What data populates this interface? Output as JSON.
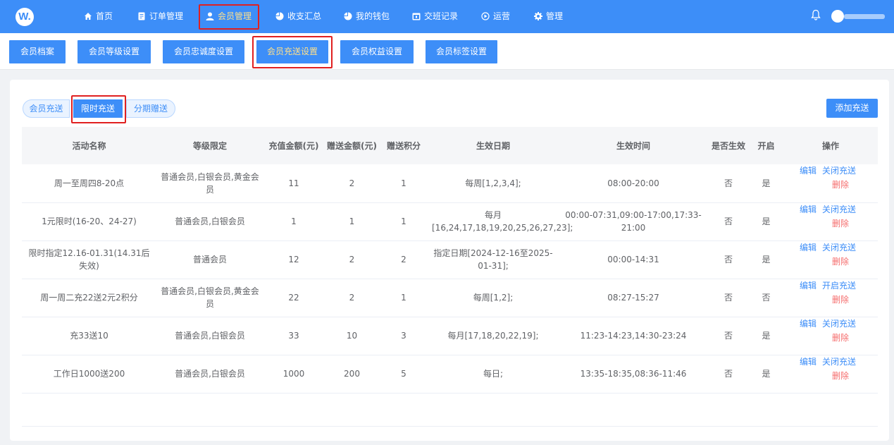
{
  "brand": {
    "logo_text": "W."
  },
  "nav": [
    {
      "label": "首页",
      "icon": "home-icon"
    },
    {
      "label": "订单管理",
      "icon": "document-icon"
    },
    {
      "label": "会员管理",
      "icon": "user-icon",
      "active": true
    },
    {
      "label": "收支汇总",
      "icon": "pie-chart-icon"
    },
    {
      "label": "我的钱包",
      "icon": "wallet-icon"
    },
    {
      "label": "交班记录",
      "icon": "calendar-icon"
    },
    {
      "label": "运营",
      "icon": "compass-icon"
    },
    {
      "label": "管理",
      "icon": "gear-icon"
    }
  ],
  "subtabs": [
    "会员档案",
    "会员等级设置",
    "会员忠诚度设置",
    "会员充送设置",
    "会员权益设置",
    "会员标签设置"
  ],
  "subtabs_active": "会员充送设置",
  "segments": [
    "会员充送",
    "限时充送",
    "分期赠送"
  ],
  "segments_active": "限时充送",
  "add_button": "添加充送",
  "table": {
    "headers": [
      "活动名称",
      "等级限定",
      "充值金额(元)",
      "赠送金额(元)",
      "赠送积分",
      "生效日期",
      "生效时间",
      "是否生效",
      "开启",
      "操作"
    ],
    "rows": [
      {
        "name": "周一至周四8-20点",
        "level": "普通会员,白银会员,黄金会员",
        "amount": "11",
        "gift": "2",
        "points": "1",
        "date": "每周[1,2,3,4];",
        "time": "08:00-20:00",
        "effective": "否",
        "enabled": "是",
        "op_edit": "编辑",
        "op_toggle": "关闭充送",
        "op_delete": "删除"
      },
      {
        "name": "1元限时(16-20、24-27)",
        "level": "普通会员,白银会员",
        "amount": "1",
        "gift": "1",
        "points": "1",
        "date": "每月[16,24,17,18,19,20,25,26,27,23];",
        "time": "00:00-07:31,09:00-17:00,17:33-21:00",
        "effective": "否",
        "enabled": "是",
        "op_edit": "编辑",
        "op_toggle": "关闭充送",
        "op_delete": "删除"
      },
      {
        "name": "限时指定12.16-01.31(14.31后失效)",
        "level": "普通会员",
        "amount": "12",
        "gift": "2",
        "points": "2",
        "date": "指定日期[2024-12-16至2025-01-31];",
        "time": "00:00-14:31",
        "effective": "否",
        "enabled": "是",
        "op_edit": "编辑",
        "op_toggle": "关闭充送",
        "op_delete": "删除"
      },
      {
        "name": "周一周二充22送2元2积分",
        "level": "普通会员,白银会员,黄金会员",
        "amount": "22",
        "gift": "2",
        "points": "1",
        "date": "每周[1,2];",
        "time": "08:27-15:27",
        "effective": "否",
        "enabled": "否",
        "op_edit": "编辑",
        "op_toggle": "开启充送",
        "op_delete": "删除"
      },
      {
        "name": "充33送10",
        "level": "普通会员,白银会员",
        "amount": "33",
        "gift": "10",
        "points": "3",
        "date": "每月[17,18,20,22,19];",
        "time": "11:23-14:23,14:30-23:24",
        "effective": "否",
        "enabled": "是",
        "op_edit": "编辑",
        "op_toggle": "关闭充送",
        "op_delete": "删除"
      },
      {
        "name": "工作日1000送200",
        "level": "普通会员,白银会员",
        "amount": "1000",
        "gift": "200",
        "points": "5",
        "date": "每日;",
        "time": "13:35-18:35,08:36-11:46",
        "effective": "否",
        "enabled": "是",
        "op_edit": "编辑",
        "op_toggle": "关闭充送",
        "op_delete": "删除"
      }
    ]
  },
  "colors": {
    "primary": "#3d8ef8",
    "active_text": "#ffe08a",
    "danger": "#f56c6c",
    "highlight_box": "#e02020"
  }
}
